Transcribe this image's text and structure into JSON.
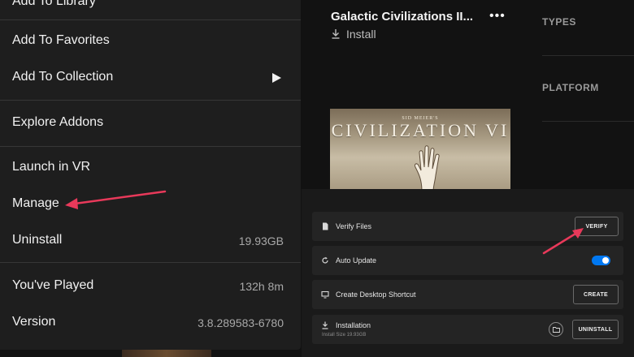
{
  "store": {
    "game_title": "Galactic Civilizations II...",
    "more_label": "•••",
    "install_label": "Install",
    "filters": {
      "types": "TYPES",
      "platform": "PLATFORM"
    },
    "cover": {
      "small_text": "SID MEIER'S",
      "title": "CIVILIZATION VI"
    }
  },
  "context_menu": {
    "items": [
      {
        "label": "Add To Library"
      },
      {
        "label": "Add To Favorites"
      },
      {
        "label": "Add To Collection",
        "submenu_icon": "triangle-right-icon"
      },
      {
        "label": "Explore Addons"
      },
      {
        "label": "Launch in VR"
      },
      {
        "label": "Manage"
      },
      {
        "label": "Uninstall",
        "value": "19.93GB"
      },
      {
        "label": "You've Played",
        "value": "132h 8m"
      },
      {
        "label": "Version",
        "value": "3.8.289583-6780"
      }
    ]
  },
  "manage_panel": {
    "verify": {
      "label": "Verify Files",
      "button": "VERIFY",
      "icon": "file-icon"
    },
    "auto_update": {
      "label": "Auto Update",
      "enabled": true,
      "icon": "refresh-icon"
    },
    "shortcut": {
      "label": "Create Desktop Shortcut",
      "button": "CREATE",
      "icon": "monitor-icon"
    },
    "installation": {
      "label": "Installation",
      "size": "Install Size 19.93GB",
      "button": "UNINSTALL",
      "icon": "download-icon"
    }
  },
  "colors": {
    "accent": "#0078f2",
    "annotation_arrow": "#e8395a",
    "menu_bg": "#1e1e1e"
  }
}
